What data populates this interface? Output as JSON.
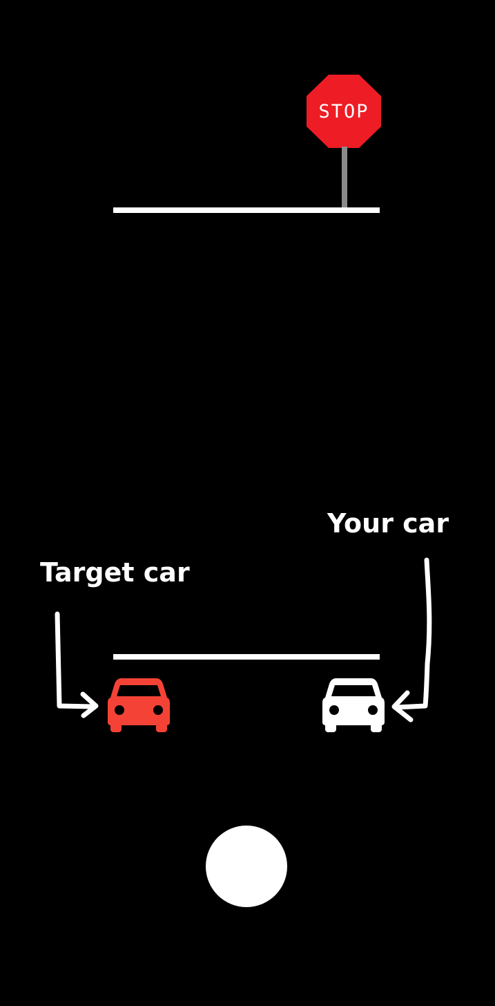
{
  "scene": {
    "background_color": "#000000"
  },
  "stop_sign": {
    "text": "STOP",
    "color": "#ee1c25",
    "pole_color": "#8a8a8a",
    "icon": "stop-sign-icon"
  },
  "labels": {
    "your_car": "Your car",
    "target_car": "Target car"
  },
  "cars": {
    "target": {
      "color": "#f44336",
      "icon": "car-icon"
    },
    "yours": {
      "color": "#ffffff",
      "icon": "car-icon"
    }
  },
  "controls": {
    "action_button_color": "#ffffff"
  }
}
